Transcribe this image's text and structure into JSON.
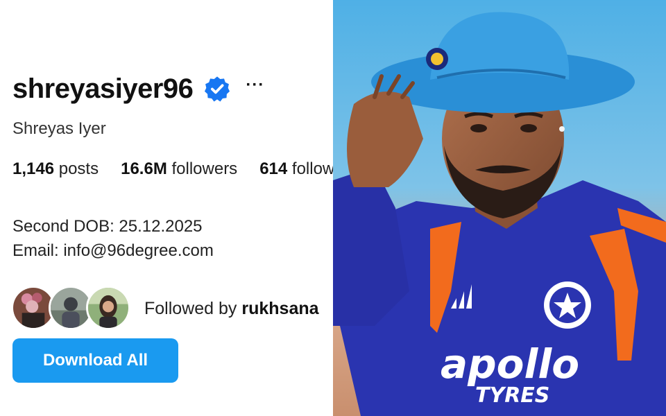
{
  "profile": {
    "username": "shreyasiyer96",
    "verified_icon": "verified-badge-icon",
    "more_label": "···",
    "full_name": "Shreyas Iyer"
  },
  "stats": {
    "posts_count": "1,146",
    "posts_label": "posts",
    "followers_count": "16.6M",
    "followers_label": "followers",
    "following_count": "614",
    "following_label": "following"
  },
  "bio": {
    "line1": "Second DOB: 25.12.2025",
    "line2": "Email: info@96degree.com"
  },
  "followed_by": {
    "prefix": "Followed by",
    "name": "rukhsana"
  },
  "actions": {
    "download_label": "Download All"
  },
  "photo": {
    "jersey_sponsor_line1": "apollo",
    "jersey_sponsor_line2": "TYRES"
  },
  "colors": {
    "accent": "#1a9af0",
    "verified": "#1877f2",
    "hat": "#2a8fd6",
    "jersey": "#2a34b0",
    "jersey_orange": "#f26b1d"
  }
}
